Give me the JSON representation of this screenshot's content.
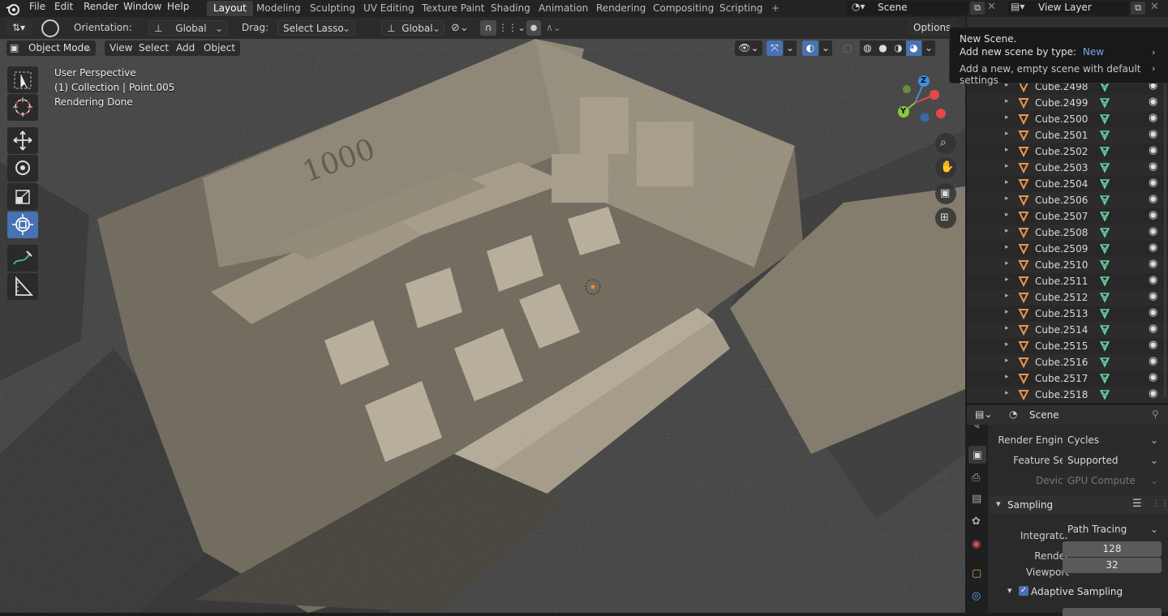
{
  "topbar": {
    "menus": [
      "File",
      "Edit",
      "Render",
      "Window",
      "Help"
    ],
    "workspaces": [
      "Layout",
      "Modeling",
      "Sculpting",
      "UV Editing",
      "Texture Paint",
      "Shading",
      "Animation",
      "Rendering",
      "Compositing",
      "Scripting"
    ],
    "active_workspace": "Layout",
    "add_workspace": "+",
    "scene_name": "Scene",
    "view_layer": "View Layer"
  },
  "header": {
    "orientation_label": "Orientation:",
    "orientation_value": "Global",
    "drag_label": "Drag:",
    "drag_value": "Select Lasso",
    "pivot_value": "Global",
    "options_label": "Options"
  },
  "viewport_header": {
    "mode": "Object Mode",
    "menus": [
      "View",
      "Select",
      "Add",
      "Object"
    ]
  },
  "viewport": {
    "overlay_lines": [
      "User Perspective",
      "(1) Collection | Point.005",
      "Rendering Done"
    ],
    "gizmo": {
      "z": "Z",
      "y": "Y"
    },
    "render_title": "1000"
  },
  "tooltip": {
    "title": "New Scene.",
    "line2_prefix": "Add new scene by type:",
    "line2_value": "New",
    "line3": "Add a new, empty scene with default settings"
  },
  "outliner": {
    "items": [
      "Cube.2498",
      "Cube.2499",
      "Cube.2500",
      "Cube.2501",
      "Cube.2502",
      "Cube.2503",
      "Cube.2504",
      "Cube.2506",
      "Cube.2507",
      "Cube.2508",
      "Cube.2509",
      "Cube.2510",
      "Cube.2511",
      "Cube.2512",
      "Cube.2513",
      "Cube.2514",
      "Cube.2515",
      "Cube.2516",
      "Cube.2517",
      "Cube.2518"
    ]
  },
  "properties": {
    "context": "Scene",
    "render_engine_label": "Render Engine",
    "render_engine": "Cycles",
    "feature_set_label": "Feature Set",
    "feature_set": "Supported",
    "device_label": "Device",
    "device": "GPU Compute",
    "sampling_label": "Sampling",
    "integrator_label": "Integrator",
    "integrator": "Path Tracing",
    "render_label": "Render",
    "render_samples": "128",
    "viewport_label": "Viewport",
    "viewport_samples": "32",
    "adaptive_label": "Adaptive Sampling"
  },
  "colors": {
    "accent": "#4772b3",
    "object_icon": "#e8974a",
    "mesh_icon": "#5fd49a",
    "gizmo_x": "#e8474a",
    "gizmo_y": "#8cc83a",
    "gizmo_z": "#3f8fe3"
  }
}
